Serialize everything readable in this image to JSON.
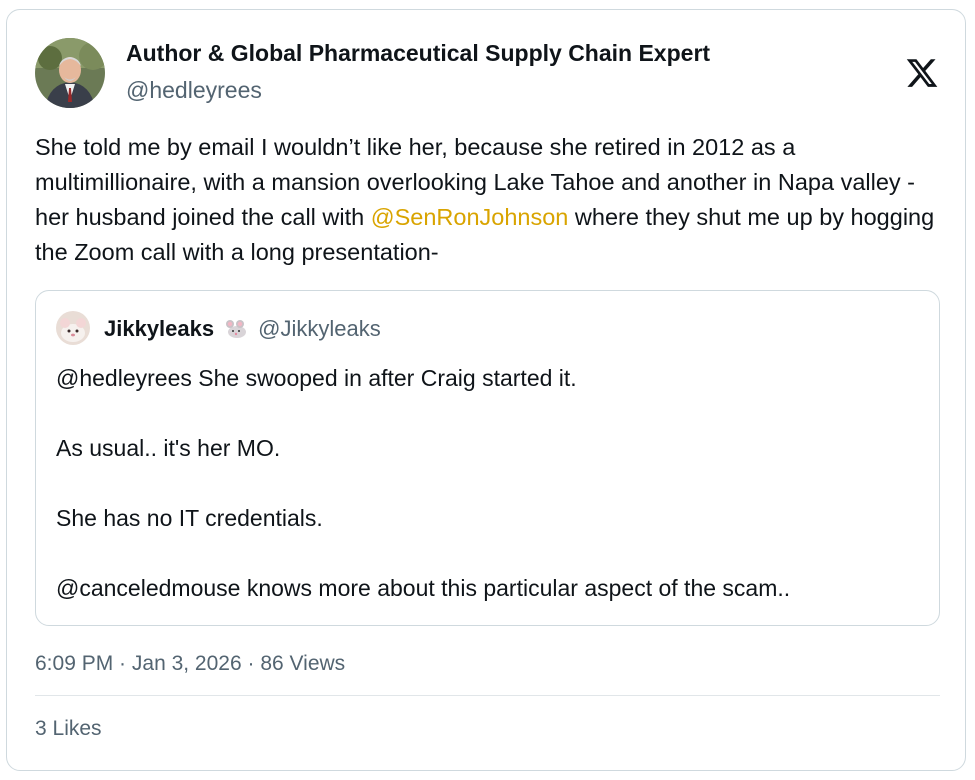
{
  "author": {
    "name": "Author & Global Pharmaceutical Supply Chain Expert",
    "handle": "@hedleyrees",
    "avatar_icon": "avatar-photo"
  },
  "platform_icon": "x-logo-icon",
  "tweet": {
    "text_before": "She told me by email I wouldn’t like her, because she retired in 2012 as a multimillionaire, with a mansion overlooking Lake Tahoe and another in Napa valley - her husband joined the call with ",
    "mention": "@SenRonJohnson",
    "text_after": " where they shut me up by hogging the Zoom call with a long presentation-",
    "mention_color": "#d9a400"
  },
  "quoted": {
    "name": "Jikkyleaks",
    "emoji_icon": "mouse-icon",
    "handle": "@Jikkyleaks",
    "paragraphs": [
      "@hedleyrees She swooped in after Craig started it.",
      "As usual.. it's her MO.",
      "She has no IT credentials.",
      "@canceledmouse knows more about this particular aspect of the scam.."
    ]
  },
  "meta": {
    "time": "6:09 PM",
    "separator": " · ",
    "date": "Jan 3, 2026",
    "views": "86 Views"
  },
  "likes": "3 Likes"
}
